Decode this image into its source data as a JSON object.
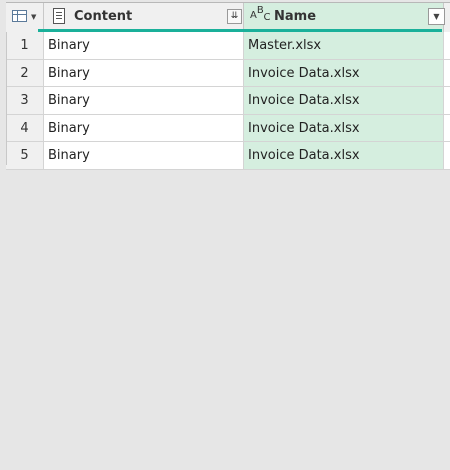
{
  "columns": [
    {
      "name": "Content",
      "type_icon": "binary-icon",
      "header_button": "expand-binary-icon"
    },
    {
      "name": "Name",
      "type_icon": "abc-text-icon",
      "header_button": "filter-dropdown-icon"
    }
  ],
  "rows": [
    {
      "index": "1",
      "content": "Binary",
      "name": "Master.xlsx"
    },
    {
      "index": "2",
      "content": "Binary",
      "name": "Invoice Data.xlsx"
    },
    {
      "index": "3",
      "content": "Binary",
      "name": "Invoice Data.xlsx"
    },
    {
      "index": "4",
      "content": "Binary",
      "name": "Invoice Data.xlsx"
    },
    {
      "index": "5",
      "content": "Binary",
      "name": "Invoice Data.xlsx"
    }
  ],
  "colors": {
    "selected_column": "#d5eedf",
    "accent_bar": "#1ab09a",
    "background": "#e6e6e6"
  },
  "icons": {
    "abc_top": "B",
    "abc_left": "A",
    "abc_bottom": "C"
  }
}
